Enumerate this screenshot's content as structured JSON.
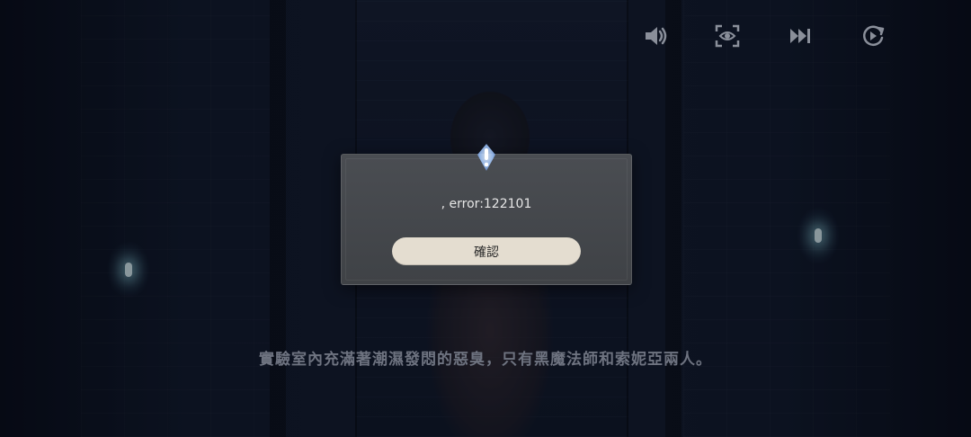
{
  "controls": [
    {
      "name": "volume-icon"
    },
    {
      "name": "hide-ui-icon"
    },
    {
      "name": "skip-icon"
    },
    {
      "name": "auto-play-icon"
    }
  ],
  "dialog": {
    "icon": "alert-icon",
    "message": ", error:122101",
    "confirm_label": "確認"
  },
  "subtitle": "實驗室內充滿著潮濕發悶的惡臭，只有黑魔法師和索妮亞兩人。",
  "colors": {
    "dialog_bg": "#45484d",
    "button_bg": "#e4ddd0",
    "alert_glow": "#9fc6ff",
    "icon_color": "#8a8f9a"
  }
}
